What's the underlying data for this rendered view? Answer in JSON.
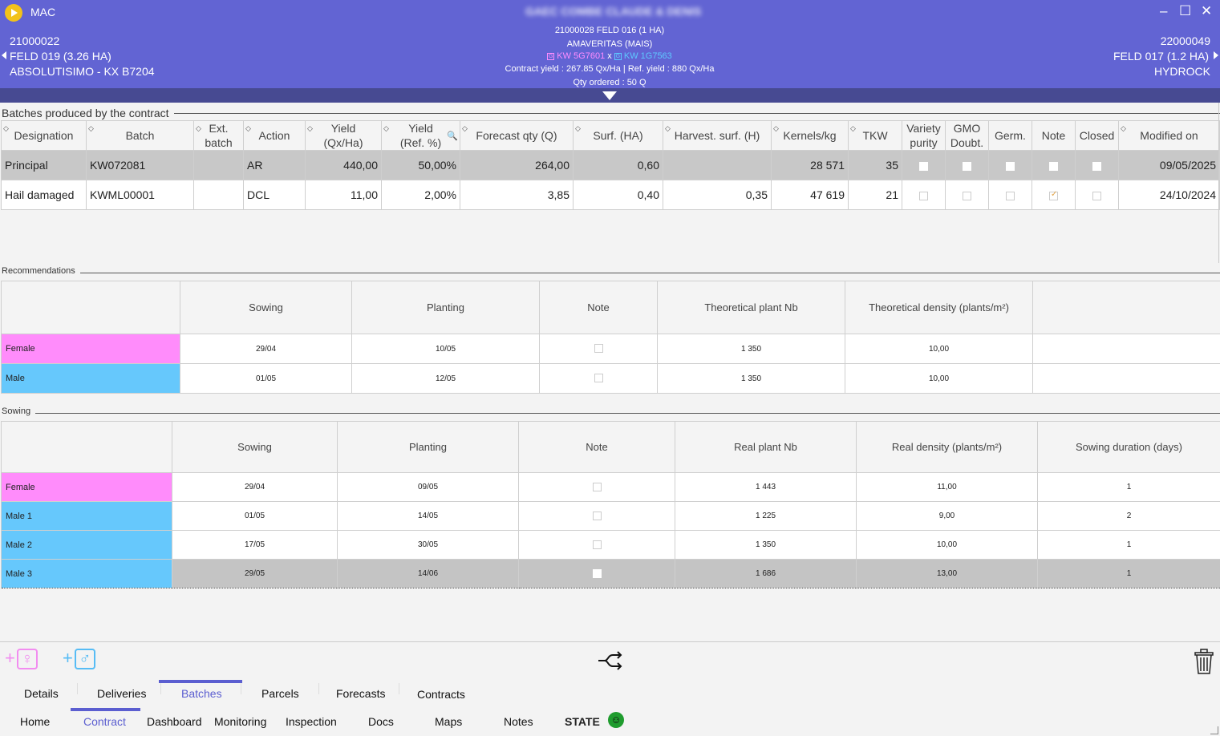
{
  "window": {
    "app_name": "MAC",
    "blurred_title": "GAEC COMBE CLAUDE & DENIS",
    "min": "–",
    "max": "☐",
    "close": "✕"
  },
  "header": {
    "left": {
      "id": "21000022",
      "field": "FELD 019 (3.26 HA)",
      "variety": "ABSOLUTISIMO - KX B7204"
    },
    "right": {
      "id": "22000049",
      "field": "FELD 017 (1.2 HA)",
      "variety": "HYDROCK"
    },
    "center": {
      "line1": "21000028 FELD 016 (1 HA)",
      "line2": "AMAVERITAS (MAIS)",
      "female": "KW 5G7601",
      "cross": "x",
      "male": "KW 1G7563",
      "gmo_mark": "G",
      "contract_yield": "Contract yield : 267.85 Qx/Ha",
      "sep": "|",
      "ref_yield": "Ref. yield : 880 Qx/Ha",
      "qty": "Qty ordered : 50 Q"
    }
  },
  "batches": {
    "title": "Batches produced by the contract",
    "sort_glyph": "◇",
    "search_glyph": "🔍",
    "columns": [
      "Designation",
      "Batch",
      "Ext.\nbatch",
      "Action",
      "Yield\n(Qx/Ha)",
      "Yield\n(Ref. %)",
      "Forecast qty (Q)",
      "Surf. (HA)",
      "Harvest. surf. (H)",
      "Kernels/kg",
      "TKW",
      "Variety\npurity",
      "GMO\nDoubt.",
      "Germ.",
      "Note",
      "Closed",
      "Modified on"
    ],
    "rows": [
      {
        "designation": "Principal",
        "batch": "KW072081",
        "ext": "",
        "action": "AR",
        "yield": "440,00",
        "yield_ref": "50,00%",
        "forecast": "264,00",
        "surf": "0,60",
        "harvest": "",
        "kernels": "28 571",
        "tkw": "35",
        "modified": "09/05/2025"
      },
      {
        "designation": "Hail damaged",
        "batch": "KWML00001",
        "ext": "",
        "action": "DCL",
        "yield": "11,00",
        "yield_ref": "2,00%",
        "forecast": "3,85",
        "surf": "0,40",
        "harvest": "0,35",
        "kernels": "47 619",
        "tkw": "21",
        "modified": "24/10/2024"
      }
    ]
  },
  "recommendations": {
    "title": "Recommendations",
    "columns": [
      "",
      "Sowing",
      "Planting",
      "Note",
      "Theoretical plant Nb",
      "Theoretical density (plants/m²)",
      ""
    ],
    "rows": [
      {
        "label": "Female",
        "sowing": "29/04",
        "planting": "10/05",
        "plants": "1 350",
        "density": "10,00"
      },
      {
        "label": "Male",
        "sowing": "01/05",
        "planting": "12/05",
        "plants": "1 350",
        "density": "10,00"
      }
    ]
  },
  "sowing": {
    "title": "Sowing",
    "columns": [
      "",
      "Sowing",
      "Planting",
      "Note",
      "Real plant Nb",
      "Real density (plants/m²)",
      "Sowing duration (days)"
    ],
    "rows": [
      {
        "label": "Female",
        "sowing": "29/04",
        "planting": "09/05",
        "plants": "1 443",
        "density": "11,00",
        "duration": "1"
      },
      {
        "label": "Male 1",
        "sowing": "01/05",
        "planting": "14/05",
        "plants": "1 225",
        "density": "9,00",
        "duration": "2"
      },
      {
        "label": "Male 2",
        "sowing": "17/05",
        "planting": "30/05",
        "plants": "1 350",
        "density": "10,00",
        "duration": "1"
      },
      {
        "label": "Male 3",
        "sowing": "29/05",
        "planting": "14/06",
        "plants": "1 686",
        "density": "13,00",
        "duration": "1"
      }
    ]
  },
  "toolbar": {
    "plus": "+",
    "female_sym": "♀",
    "male_sym": "♂",
    "shuffle": "⇨",
    "trash": "🗑"
  },
  "tabs_top": [
    "Details",
    "Deliveries",
    "Batches",
    "Parcels",
    "Forecasts",
    "Contracts"
  ],
  "tabs_bottom": [
    "Home",
    "Contract",
    "Dashboard",
    "Monitoring",
    "Inspection",
    "Docs",
    "Maps",
    "Notes"
  ],
  "state": {
    "label": "STATE",
    "icon": "☺"
  },
  "colors": {
    "header": "#6264d3",
    "female": "#ff8cfb",
    "male": "#66c8fc",
    "accent": "#5b5ed0"
  }
}
